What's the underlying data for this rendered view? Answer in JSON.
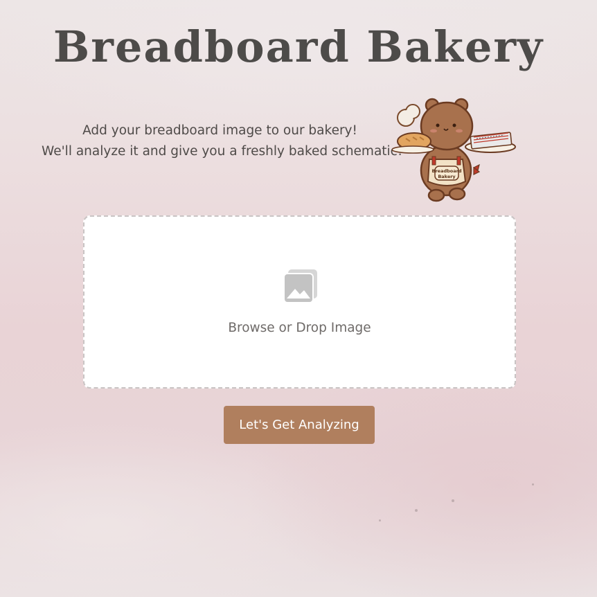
{
  "header": {
    "title": "Breadboard Bakery"
  },
  "intro": {
    "line1": "Add your breadboard image to our bakery!",
    "line2": "We'll analyze it and give you a freshly baked schematic!"
  },
  "mascot": {
    "apron_text_1": "Breadboard",
    "apron_text_2": "Bakery"
  },
  "upload": {
    "label": "Browse or Drop Image",
    "icon": "image-gallery-icon"
  },
  "actions": {
    "analyze_label": "Let's Get Analyzing"
  },
  "colors": {
    "title": "#4d4b49",
    "button": "#b07f5e",
    "dropzone_border": "#c9c4c4",
    "background": "#e9d3d6"
  }
}
